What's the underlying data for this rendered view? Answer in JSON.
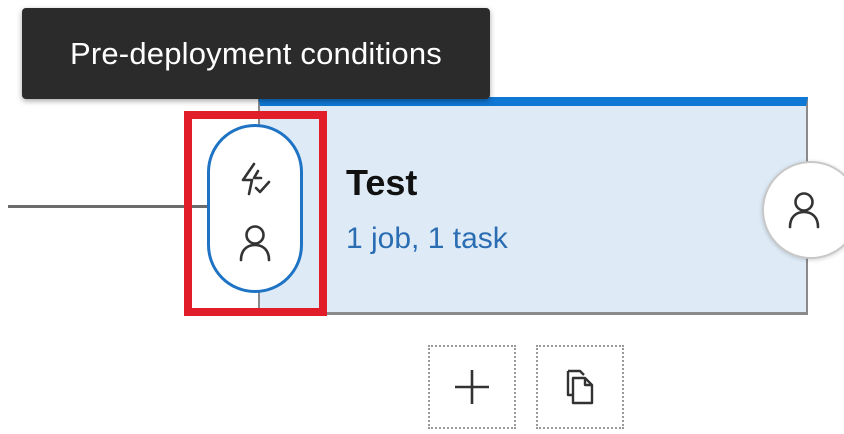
{
  "tooltip": {
    "text": "Pre-deployment conditions"
  },
  "stage": {
    "name": "Test",
    "summary": "1 job, 1 task",
    "accent_color": "#0f78d4",
    "card_background": "#deebf7",
    "summary_color": "#2a6db3"
  },
  "highlight": {
    "color": "#e11d2a"
  },
  "pre_deployment": {
    "icons": [
      "trigger-icon",
      "approver-icon"
    ]
  },
  "post_deployment": {
    "icons": [
      "approver-icon"
    ]
  },
  "actions": {
    "icons": [
      "add-icon",
      "clone-icon"
    ]
  }
}
